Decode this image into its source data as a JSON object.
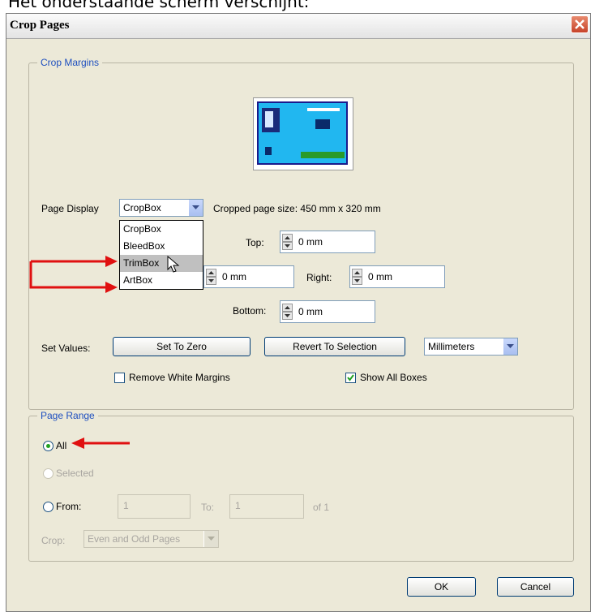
{
  "caption": "Het onderstaande scherm verschijnt:",
  "dialog": {
    "title": "Crop Pages"
  },
  "crop_margins": {
    "legend": "Crop Margins",
    "page_display_label": "Page Display",
    "page_display_value": "CropBox",
    "page_display_options": [
      "CropBox",
      "BleedBox",
      "TrimBox",
      "ArtBox"
    ],
    "highlighted_option": "TrimBox",
    "cropped_size": "Cropped page size: 450 mm x 320 mm",
    "top_label": "Top:",
    "top_value": "0 mm",
    "left_value": "0 mm",
    "right_label": "Right:",
    "right_value": "0 mm",
    "bottom_label": "Bottom:",
    "bottom_value": "0 mm",
    "set_values_label": "Set Values:",
    "set_to_zero": "Set To Zero",
    "revert_to_selection": "Revert To Selection",
    "units_value": "Millimeters",
    "remove_white_margins": "Remove White Margins",
    "remove_white_margins_checked": false,
    "show_all_boxes": "Show All Boxes",
    "show_all_boxes_checked": true
  },
  "page_range": {
    "legend": "Page Range",
    "all": "All",
    "selected": "Selected",
    "from": "From:",
    "from_value": "1",
    "to": "To:",
    "to_value": "1",
    "of": "of 1",
    "crop_label": "Crop:",
    "crop_value": "Even and Odd Pages",
    "selected_option": "All"
  },
  "buttons": {
    "ok": "OK",
    "cancel": "Cancel"
  },
  "colors": {
    "annotation_arrow": "#e01010",
    "legend_text": "#1e4fbf",
    "thumbnail_page": "#21b7f0"
  },
  "icons": [
    "close-icon",
    "dropdown-arrow-icon",
    "spinner-icon",
    "checkmark-icon",
    "mouse-cursor-icon",
    "red-arrow-annotation"
  ]
}
